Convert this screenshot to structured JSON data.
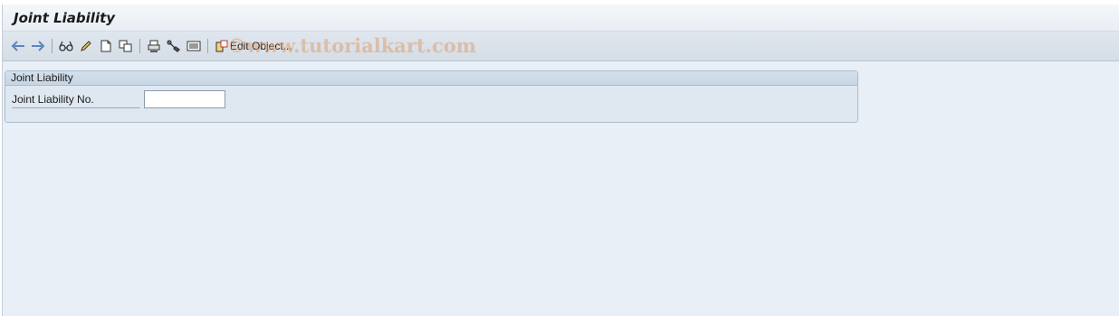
{
  "title": "Joint Liability",
  "toolbar": {
    "icons": [
      "back-arrow-icon",
      "forward-arrow-icon",
      "display-glasses-icon",
      "pencil-icon",
      "new-document-icon",
      "copy-icon",
      "print-icon",
      "tools-icon",
      "list-icon",
      "edit-object-icon"
    ],
    "edit_object_label": "Edit Object..."
  },
  "watermark": "©www.tutorialkart.com",
  "group": {
    "title": "Joint Liability",
    "fields": [
      {
        "label": "Joint Liability No.",
        "value": ""
      }
    ]
  },
  "colors": {
    "background": "#e9eff6",
    "toolbar": "#d9e1ea",
    "arrow_blue": "#5b86c0",
    "watermark": "#dea06e"
  }
}
